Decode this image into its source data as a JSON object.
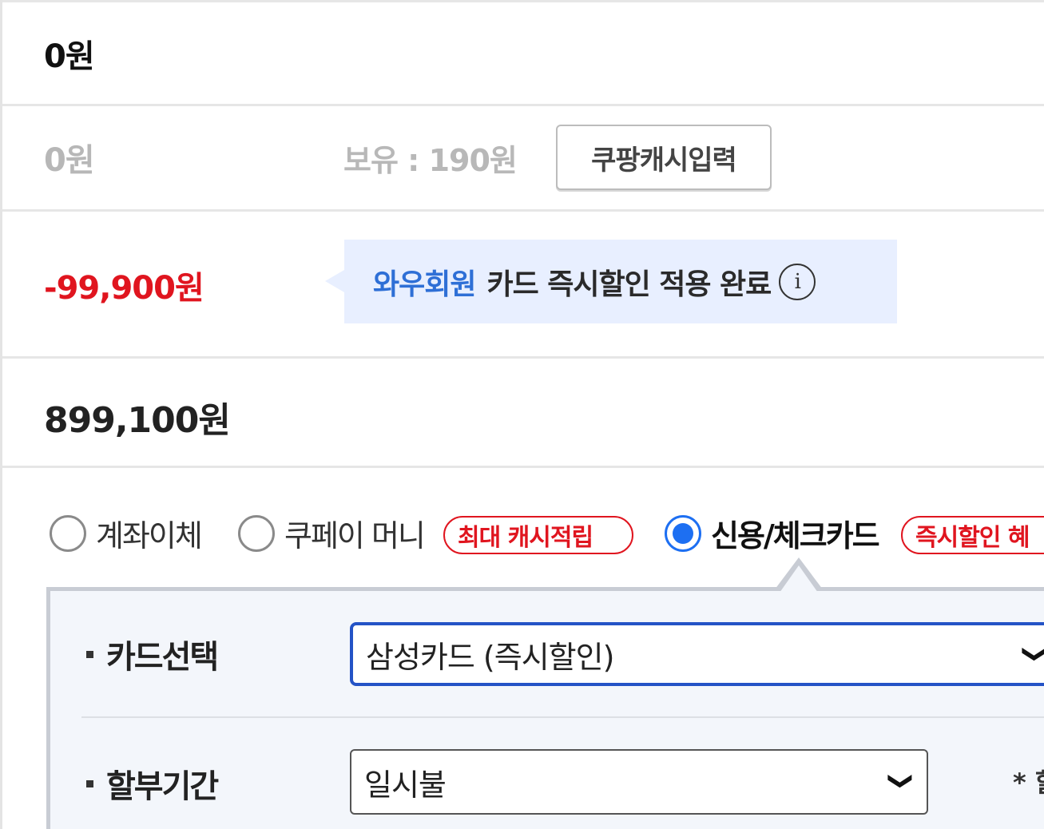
{
  "summary": {
    "row1_amount": "0원",
    "cash_amount": "0원",
    "cash_balance": "보유 : 190원",
    "cash_button": "쿠팡캐시입력",
    "discount_amount": "-99,900원",
    "promo_highlight": "와우회원",
    "promo_text": "카드 즉시할인 적용 완료",
    "info_icon": "i",
    "total_amount": "899,100원"
  },
  "payment_methods": [
    {
      "label": "계좌이체",
      "selected": false
    },
    {
      "label": "쿠페이 머니",
      "selected": false,
      "badge": "최대 캐시적립"
    },
    {
      "label": "신용/체크카드",
      "selected": true,
      "badge": "즉시할인 혜"
    }
  ],
  "card_panel": {
    "card_label": "카드선택",
    "card_value": "삼성카드 (즉시할인)",
    "installment_label": "할부기간",
    "installment_value": "일시불",
    "note": "* 할",
    "chevron": "❯"
  },
  "colors": {
    "discount_red": "#e0151f",
    "accent_blue": "#2e6fd6",
    "radio_blue": "#1d6ff2",
    "promo_bg": "#e8efff",
    "select_border": "#2453c6"
  }
}
